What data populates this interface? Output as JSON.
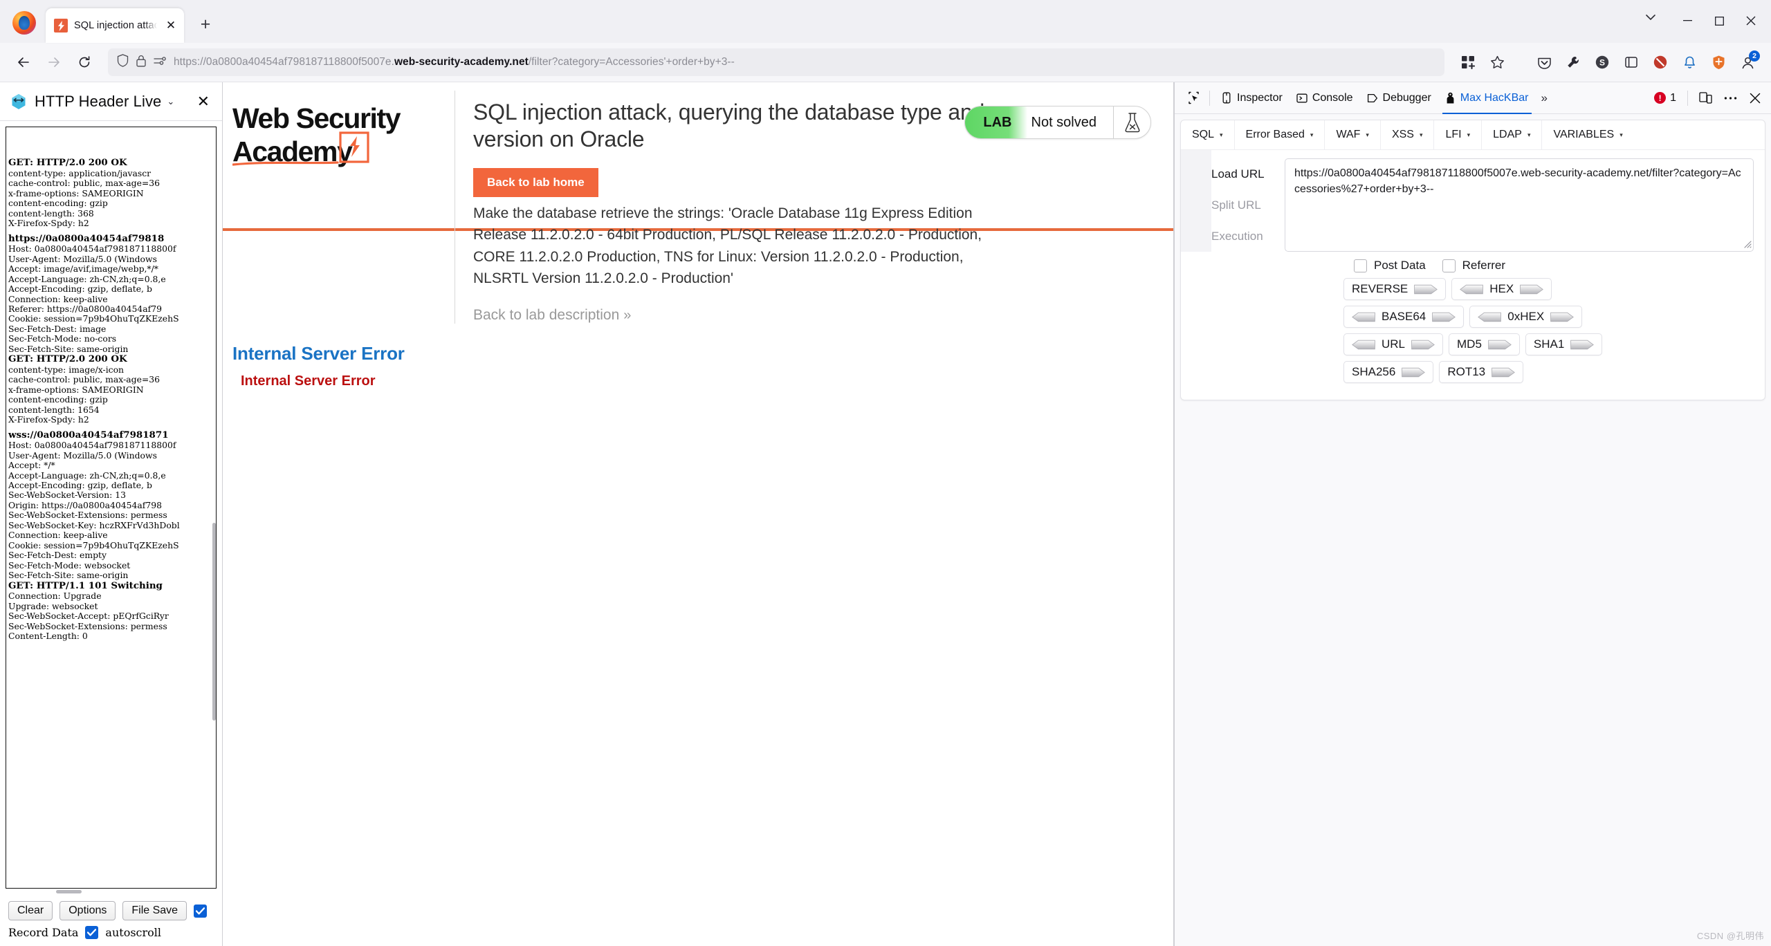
{
  "browser": {
    "tab": {
      "title": "SQL injection attack, querying the database type and version on Oracle",
      "favicon": "portswigger-favicon-icon",
      "close_label": "✕"
    },
    "newtab_label": "+",
    "window_controls": {
      "minimize": "─",
      "maximize": "☐",
      "close": "✕"
    },
    "url": {
      "scheme_host_pre": "https://0a0800a40454af798187118800f5007e.",
      "host_bold": "web-security-academy.net",
      "path": "/filter?category=Accessories'+order+by+3--"
    },
    "toolbar_icons": [
      "back-icon",
      "forward-icon",
      "reload-icon",
      "shield-icon",
      "lock-icon",
      "permissions-icon",
      "extensions-grid-icon",
      "bookmark-star-icon",
      "pocket-icon",
      "wrench-icon",
      "s-extension-icon",
      "container-icon",
      "blocker-icon",
      "notification-icon",
      "shield-extension-icon",
      "account-icon"
    ],
    "account_badge": "2"
  },
  "sidebar": {
    "title": "HTTP Header Live",
    "icon": "http-header-live-icon",
    "caret": "⌄",
    "close": "✕",
    "log": [
      {
        "type": "header",
        "text": "GET: HTTP/2.0 200 OK"
      },
      {
        "type": "line",
        "text": "content-type: application/javascr"
      },
      {
        "type": "line",
        "text": "cache-control: public, max-age=36"
      },
      {
        "type": "line",
        "text": "x-frame-options: SAMEORIGIN"
      },
      {
        "type": "line",
        "text": "content-encoding: gzip"
      },
      {
        "type": "line",
        "text": "content-length: 368"
      },
      {
        "type": "line",
        "text": "X-Firefox-Spdy: h2"
      },
      {
        "type": "gap",
        "text": ""
      },
      {
        "type": "url",
        "text": "https://0a0800a40454af79818"
      },
      {
        "type": "line",
        "text": "Host: 0a0800a40454af798187118800f"
      },
      {
        "type": "line",
        "text": "User-Agent: Mozilla/5.0 (Windows "
      },
      {
        "type": "line",
        "text": "Accept: image/avif,image/webp,*/*"
      },
      {
        "type": "line",
        "text": "Accept-Language: zh-CN,zh;q=0.8,e"
      },
      {
        "type": "line",
        "text": "Accept-Encoding: gzip, deflate, b"
      },
      {
        "type": "line",
        "text": "Connection: keep-alive"
      },
      {
        "type": "line",
        "text": "Referer: https://0a0800a40454af79"
      },
      {
        "type": "line",
        "text": "Cookie: session=7p9b4OhuTqZKEzehS"
      },
      {
        "type": "line",
        "text": "Sec-Fetch-Dest: image"
      },
      {
        "type": "line",
        "text": "Sec-Fetch-Mode: no-cors"
      },
      {
        "type": "line",
        "text": "Sec-Fetch-Site: same-origin"
      },
      {
        "type": "header",
        "text": "GET: HTTP/2.0 200 OK"
      },
      {
        "type": "line",
        "text": "content-type: image/x-icon"
      },
      {
        "type": "line",
        "text": "cache-control: public, max-age=36"
      },
      {
        "type": "line",
        "text": "x-frame-options: SAMEORIGIN"
      },
      {
        "type": "line",
        "text": "content-encoding: gzip"
      },
      {
        "type": "line",
        "text": "content-length: 1654"
      },
      {
        "type": "line",
        "text": "X-Firefox-Spdy: h2"
      },
      {
        "type": "gap",
        "text": ""
      },
      {
        "type": "url",
        "text": "wss://0a0800a40454af7981871"
      },
      {
        "type": "line",
        "text": "Host: 0a0800a40454af798187118800f"
      },
      {
        "type": "line",
        "text": "User-Agent: Mozilla/5.0 (Windows "
      },
      {
        "type": "line",
        "text": "Accept: */*"
      },
      {
        "type": "line",
        "text": "Accept-Language: zh-CN,zh;q=0.8,e"
      },
      {
        "type": "line",
        "text": "Accept-Encoding: gzip, deflate, b"
      },
      {
        "type": "line",
        "text": "Sec-WebSocket-Version: 13"
      },
      {
        "type": "line",
        "text": "Origin: https://0a0800a40454af798"
      },
      {
        "type": "line",
        "text": "Sec-WebSocket-Extensions: permess"
      },
      {
        "type": "line",
        "text": "Sec-WebSocket-Key: hczRXFrVd3hDobl"
      },
      {
        "type": "line",
        "text": "Connection: keep-alive"
      },
      {
        "type": "line",
        "text": "Cookie: session=7p9b4OhuTqZKEzehS"
      },
      {
        "type": "line",
        "text": "Sec-Fetch-Dest: empty"
      },
      {
        "type": "line",
        "text": "Sec-Fetch-Mode: websocket"
      },
      {
        "type": "line",
        "text": "Sec-Fetch-Site: same-origin"
      },
      {
        "type": "header",
        "text": "GET: HTTP/1.1 101 Switching"
      },
      {
        "type": "line",
        "text": "Connection: Upgrade"
      },
      {
        "type": "line",
        "text": "Upgrade: websocket"
      },
      {
        "type": "line",
        "text": "Sec-WebSocket-Accept: pEQrfGciRyr"
      },
      {
        "type": "line",
        "text": "Sec-WebSocket-Extensions: permess"
      },
      {
        "type": "line",
        "text": "Content-Length: 0"
      }
    ],
    "buttons": {
      "clear": "Clear",
      "options": "Options",
      "file_save": "File Save"
    },
    "record_data_label": "Record Data",
    "autoscroll_label": "autoscroll",
    "record_checked": true,
    "autoscroll_checked": true
  },
  "page": {
    "logo": {
      "line1": "Web Security",
      "line2": "Academy"
    },
    "lab_title": "SQL injection attack, querying the database type and version on Oracle",
    "back_to_lab_home": "Back to lab home",
    "lab_description": "Make the database retrieve the strings: 'Oracle Database 11g Express Edition Release 11.2.0.2.0 - 64bit Production, PL/SQL Release 11.2.0.2.0 - Production, CORE 11.2.0.2.0 Production, TNS for Linux: Version 11.2.0.2.0 - Production, NLSRTL Version 11.2.0.2.0 - Production'",
    "back_to_lab_description": "Back to lab description",
    "back_chevron": "»",
    "status": {
      "lab_label": "LAB",
      "state": "Not solved",
      "flask": "flask-icon"
    },
    "error_title": "Internal Server Error",
    "error_subtitle": "Internal Server Error",
    "accent_color": "#e66a3c",
    "button_color": "#f2663c",
    "error_title_color": "#1a73c4",
    "error_sub_color": "#bb1010"
  },
  "devtools": {
    "picker_icon": "element-picker-icon",
    "tabs": [
      {
        "label": "Inspector",
        "icon": "inspector-icon",
        "active": false
      },
      {
        "label": "Console",
        "icon": "console-icon",
        "active": false
      },
      {
        "label": "Debugger",
        "icon": "debugger-icon",
        "active": false
      },
      {
        "label": "Max HacKBar",
        "icon": "hackbar-icon",
        "active": true
      }
    ],
    "overflow_chevron": "»",
    "error_count": "1",
    "responsive_icon": "responsive-design-icon",
    "meatball_icon": "more-options-icon",
    "close_icon": "close-devtools-icon",
    "hackbar": {
      "menus": [
        "SQL",
        "Error Based",
        "WAF",
        "XSS",
        "LFI",
        "LDAP",
        "VARIABLES"
      ],
      "menu_caret": "▾",
      "actions": [
        {
          "label": "Load URL",
          "icon": "link-icon",
          "dim": false
        },
        {
          "label": "Split URL",
          "icon": "scissors-icon",
          "dim": true
        },
        {
          "label": "Execution",
          "icon": "refresh-icon",
          "dim": true
        }
      ],
      "url_value": "https://0a0800a40454af798187118800f5007e.web-security-academy.net/filter?category=Accessories%27+order+by+3--",
      "checkboxes": [
        {
          "label": "Post Data",
          "checked": false
        },
        {
          "label": "Referrer",
          "checked": false
        }
      ],
      "encoder_rows": [
        [
          {
            "label": "REVERSE",
            "left": false,
            "right": true
          },
          {
            "label": "HEX",
            "left": true,
            "right": true
          }
        ],
        [
          {
            "label": "BASE64",
            "left": true,
            "right": true
          },
          {
            "label": "0xHEX",
            "left": true,
            "right": true
          }
        ],
        [
          {
            "label": "URL",
            "left": true,
            "right": true
          },
          {
            "label": "MD5",
            "left": false,
            "right": true
          },
          {
            "label": "SHA1",
            "left": false,
            "right": true
          }
        ],
        [
          {
            "label": "SHA256",
            "left": false,
            "right": true
          },
          {
            "label": "ROT13",
            "left": false,
            "right": true
          }
        ]
      ]
    }
  },
  "watermark": "CSDN @孔明伟"
}
